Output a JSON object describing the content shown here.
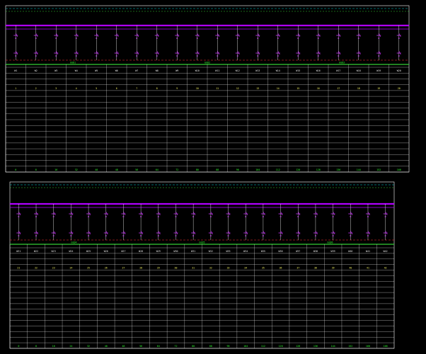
{
  "colors": {
    "background": "#000000",
    "grid_line": "#ffffff",
    "busbar": "#b000ff",
    "green_line": "#33cc33",
    "cyan_dash": "#00cccc",
    "red_dash": "#ff3333",
    "yellow": "#ffff66",
    "magenta_symbol": "#cc33ff"
  },
  "top_panel": {
    "section_labels": [
      "GGD1",
      "GGD2",
      "GGD3"
    ],
    "column_codes": [
      "W1",
      "W2",
      "W3",
      "W4",
      "W5",
      "W6",
      "W7",
      "W8",
      "W9",
      "W10",
      "W11",
      "W12",
      "W13",
      "W14",
      "W15",
      "W16",
      "W17",
      "W18",
      "W19",
      "W20"
    ],
    "mid_numbers": [
      "1",
      "2",
      "3",
      "4",
      "5",
      "6",
      "7",
      "8",
      "9",
      "10",
      "11",
      "12",
      "13",
      "14",
      "15",
      "16",
      "17",
      "18",
      "19",
      "20"
    ],
    "bottom_values": [
      "0",
      "8",
      "16",
      "32",
      "40",
      "48",
      "56",
      "64",
      "72",
      "80",
      "88",
      "96",
      "104",
      "112",
      "120",
      "128",
      "136",
      "144",
      "152",
      "160"
    ]
  },
  "bottom_panel": {
    "section_labels": [
      "GGD4",
      "GGD5",
      "GGD6"
    ],
    "column_codes": [
      "W21",
      "W22",
      "W23",
      "W24",
      "W25",
      "W26",
      "W27",
      "W28",
      "W29",
      "W30",
      "W31",
      "W32",
      "W33",
      "W34",
      "W35",
      "W36",
      "W37",
      "W38",
      "W39",
      "W40",
      "W41",
      "W42"
    ],
    "mid_numbers": [
      "21",
      "22",
      "23",
      "24",
      "25",
      "26",
      "27",
      "28",
      "29",
      "30",
      "31",
      "32",
      "33",
      "34",
      "35",
      "36",
      "37",
      "38",
      "39",
      "40",
      "41",
      "42"
    ],
    "bottom_values": [
      "0",
      "8",
      "16",
      "24",
      "32",
      "40",
      "48",
      "56",
      "64",
      "72",
      "80",
      "88",
      "96",
      "104",
      "112",
      "120",
      "128",
      "136",
      "144",
      "152",
      "160",
      "168"
    ]
  }
}
